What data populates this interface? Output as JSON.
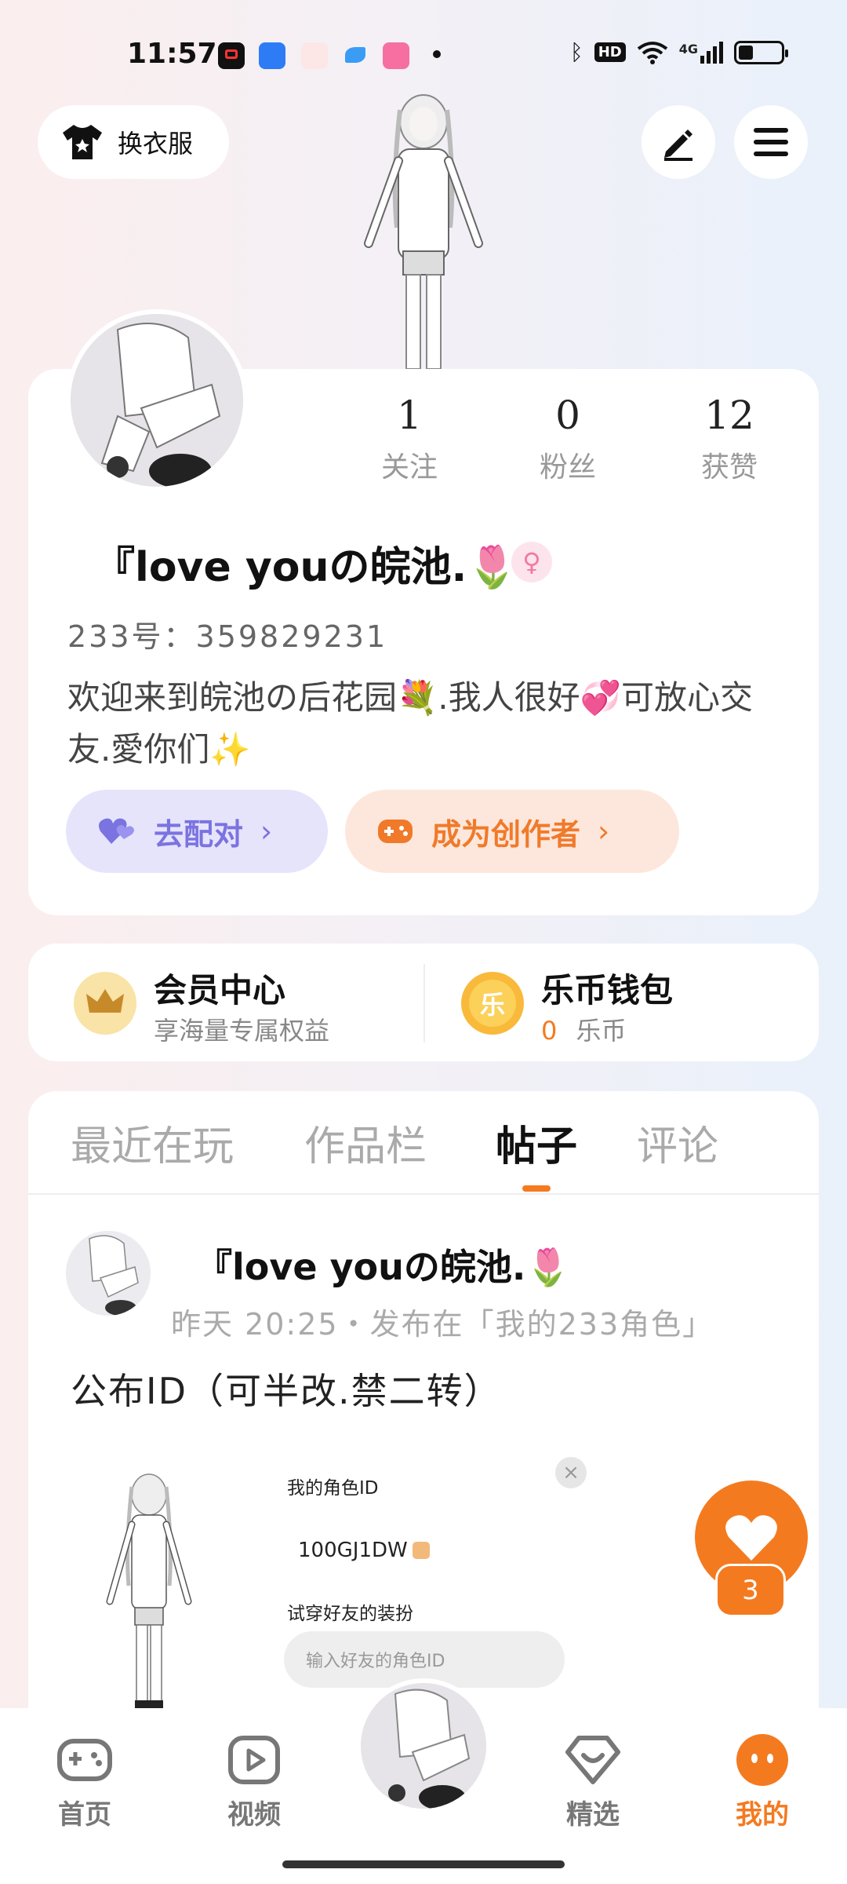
{
  "status_bar": {
    "time": "11:57",
    "network": "4G",
    "hd": "HD",
    "battery_level": 0.35
  },
  "header": {
    "outfit_label": "换衣服"
  },
  "profile": {
    "stats": [
      {
        "value": "1",
        "label": "关注"
      },
      {
        "value": "0",
        "label": "粉丝"
      },
      {
        "value": "12",
        "label": "获赞"
      }
    ],
    "nickname": "『love youの皖池.🌷",
    "gender_symbol": "♀",
    "uid": "233号：359829231",
    "bio": "欢迎来到皖池の后花园💐.我人很好💞可放心交友.愛你们✨",
    "match_label": "去配对",
    "creator_label": "成为创作者"
  },
  "membership": {
    "vip_title": "会员中心",
    "vip_sub": "享海量专属权益",
    "wallet_title": "乐币钱包",
    "wallet_icon_text": "乐",
    "wallet_amount": "0",
    "wallet_unit": "乐币"
  },
  "tabs": [
    {
      "label": "最近在玩"
    },
    {
      "label": "作品栏"
    },
    {
      "label": "帖子"
    },
    {
      "label": "评论"
    }
  ],
  "post": {
    "author": "『love youの皖池.🌷",
    "meta": "昨天 20:25・发布在「我的233角色」",
    "text": "公布ID（可半改.禁二转）",
    "card_title": "我的角色ID",
    "card_id": "100GJ1DW",
    "card_try": "试穿好友的装扮",
    "card_placeholder": "输入好友的角色ID",
    "close_symbol": "×"
  },
  "like": {
    "count": "3"
  },
  "nav": {
    "home": "首页",
    "video": "视频",
    "featured": "精选",
    "mine": "我的"
  },
  "colors": {
    "accent": "#f47a20",
    "match": "#7b73e0",
    "creator": "#f07a2a"
  }
}
